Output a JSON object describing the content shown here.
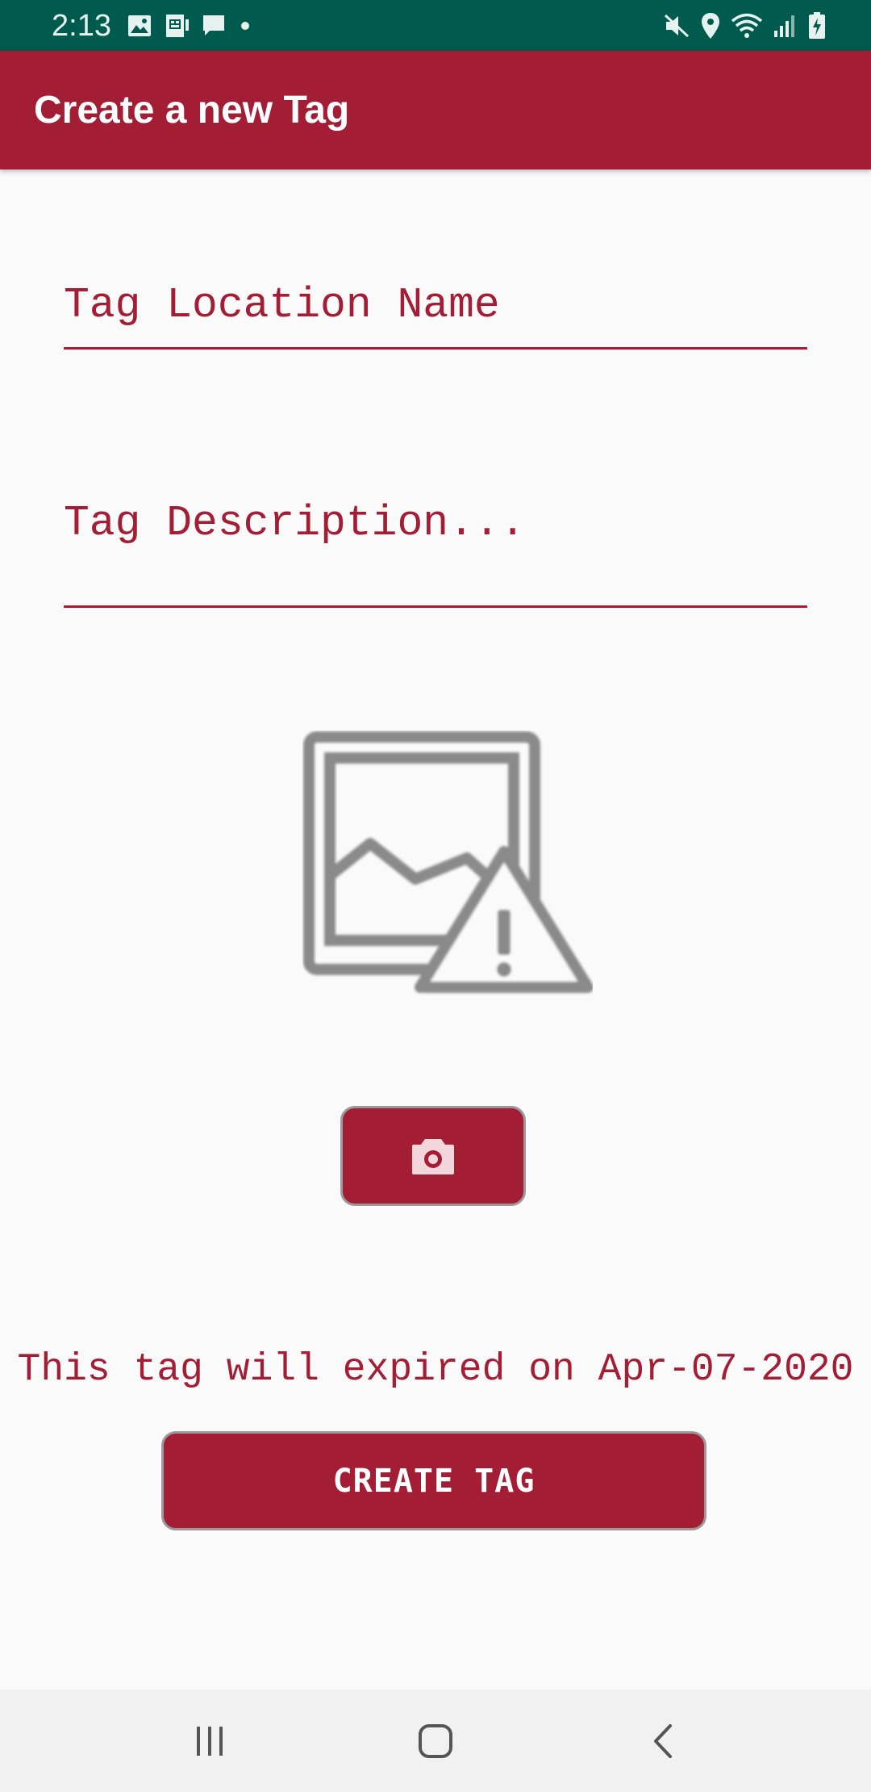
{
  "status_bar": {
    "time": "2:13",
    "left_icons": [
      "image-icon",
      "sim-card-icon",
      "message-icon",
      "dot-icon"
    ],
    "right_icons": [
      "mute-icon",
      "location-icon",
      "wifi-icon",
      "signal-icon",
      "battery-charging-icon"
    ]
  },
  "app_bar": {
    "title": "Create a new Tag"
  },
  "form": {
    "location_name_placeholder": "Tag Location Name",
    "description_placeholder": "Tag Description...",
    "image_icon": "broken-image-icon",
    "camera_icon": "camera-icon"
  },
  "expiry": {
    "text": "This tag will expired on Apr-07-2020"
  },
  "create_button": {
    "label": "CREATE TAG"
  },
  "nav_bar": {
    "icons": [
      "recents-icon",
      "home-icon",
      "back-icon"
    ]
  },
  "colors": {
    "status_bar": "#005a4d",
    "accent": "#a31d35",
    "background": "#fafafa"
  }
}
